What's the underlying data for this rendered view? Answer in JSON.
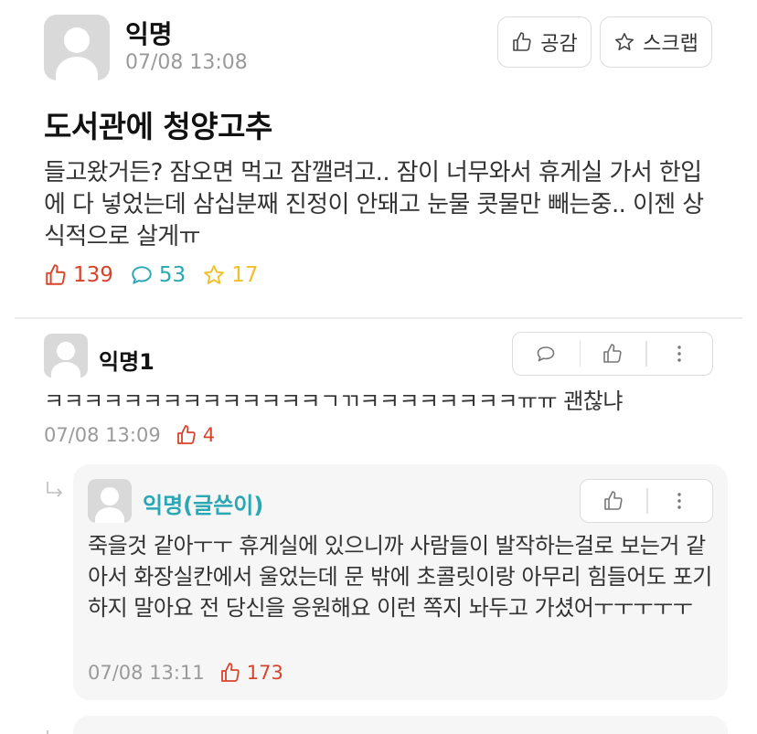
{
  "post": {
    "author": "익명",
    "time": "07/08 13:08",
    "like_button": "공감",
    "scrap_button": "스크랩",
    "title": "도서관에 청양고추",
    "body": "들고왔거든? 잠오면 먹고 잠깰려고..  잠이 너무와서 휴게실 가서 한입에 다 넣었는데 삼십분째 진정이 안돼고 눈물 콧물만 빼는중.. 이젠 상식적으로 살게ㅠ",
    "likes": "139",
    "comments": "53",
    "scraps": "17"
  },
  "comments": [
    {
      "author": "익명1",
      "text": "ㅋㅋㅋㅋㅋㅋㅋㅋㅋㅋㅋㅋㅋㅋㄱㄲㅋㅋㅋㅋㅋㅋㅋㅋㅠㅠ 괜찮냐",
      "time": "07/08 13:09",
      "likes": "4"
    }
  ],
  "replies": [
    {
      "author": "익명(글쓴이)",
      "text": "죽을것 같아ㅜㅜ 휴게실에 있으니까 사람들이 발작하는걸로 보는거 같아서 화장실칸에서 울었는데 문 밖에 초콜릿이랑 아무리 힘들어도 포기하지 말아요 전 당신을 응원해요 이런 쪽지 놔두고 가셨어ㅜㅜㅜㅜㅜ",
      "time": "07/08 13:11",
      "likes": "173"
    }
  ],
  "colors": {
    "like_red": "#d8432b",
    "comment_teal": "#2aa7b5",
    "scrap_yellow": "#f0c02a",
    "author_teal": "#2aa7b5"
  },
  "icons": {
    "thumbs_up": "thumbs-up-icon",
    "star": "star-icon",
    "speech": "speech-bubble-icon",
    "more": "more-vertical-icon",
    "reply_arrow": "reply-arrow-icon"
  }
}
